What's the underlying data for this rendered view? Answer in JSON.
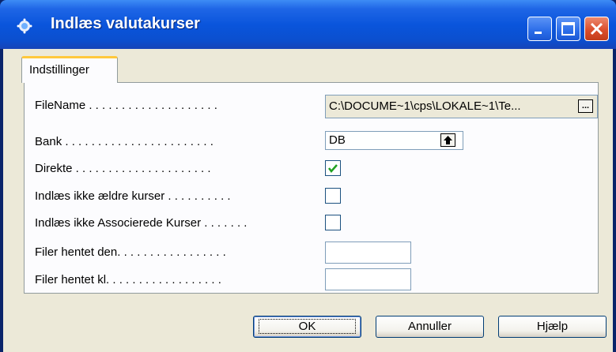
{
  "window": {
    "title": "Indlæs valutakurser"
  },
  "tabs": [
    {
      "label": "Indstillinger"
    }
  ],
  "form": {
    "filename": {
      "label": "FileName . . . . . . . . . . . . . . . . . . . .",
      "value": "C:\\DOCUME~1\\cps\\LOKALE~1\\Te...",
      "button": "..."
    },
    "bank": {
      "label": "Bank . . . . . . . . . . . . . . . . . . . . . . .",
      "value": "DB"
    },
    "direkte": {
      "label": "Direkte . . . . . . . . . . . . . . . . . . . . .",
      "checked": true
    },
    "ikke_aeldre": {
      "label": "Indlæs ikke ældre kurser . . . . . . . . . .",
      "checked": false
    },
    "ikke_associerede": {
      "label": "Indlæs ikke Associerede Kurser . . . . . . .",
      "checked": false
    },
    "filer_dato": {
      "label": "Filer hentet den. . . . . . . . . . . . . . . . .",
      "value": ""
    },
    "filer_kl": {
      "label": "Filer hentet kl. . . . . . . . . . . . . . . . . .",
      "value": ""
    }
  },
  "buttons": {
    "ok": "OK",
    "cancel": "Annuller",
    "help": "Hjælp"
  },
  "colors": {
    "titlebar": "#0a55dc",
    "face": "#ece9d8",
    "tab_accent": "#ffc83c"
  }
}
